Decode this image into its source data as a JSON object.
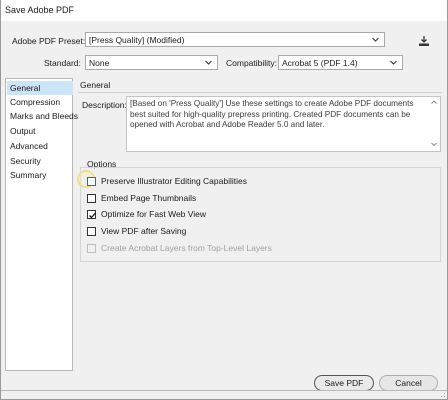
{
  "window": {
    "title": "Save Adobe PDF"
  },
  "preset": {
    "label": "Adobe PDF Preset:",
    "value": "[Press Quality] (Modified)"
  },
  "standard": {
    "label": "Standard:",
    "value": "None"
  },
  "compatibility": {
    "label": "Compatibility:",
    "value": "Acrobat 5 (PDF 1.4)"
  },
  "sidebar": {
    "items": [
      {
        "label": "General",
        "selected": true
      },
      {
        "label": "Compression"
      },
      {
        "label": "Marks and Bleeds"
      },
      {
        "label": "Output"
      },
      {
        "label": "Advanced"
      },
      {
        "label": "Security"
      },
      {
        "label": "Summary"
      }
    ]
  },
  "general": {
    "heading": "General",
    "description_label": "Description:",
    "description": "[Based on 'Press Quality'] Use these settings to create Adobe PDF documents best suited for high-quality prepress printing.  Created PDF documents can be opened with Acrobat and Adobe Reader 5.0 and later."
  },
  "options": {
    "title": "Options",
    "items": [
      {
        "label": "Preserve Illustrator Editing Capabilities",
        "checked": false,
        "enabled": true
      },
      {
        "label": "Embed Page Thumbnails",
        "checked": false,
        "enabled": true
      },
      {
        "label": "Optimize for Fast Web View",
        "checked": true,
        "enabled": true
      },
      {
        "label": "View PDF after Saving",
        "checked": false,
        "enabled": true
      },
      {
        "label": "Create Acrobat Layers from Top-Level Layers",
        "checked": false,
        "enabled": false
      }
    ]
  },
  "buttons": {
    "save": "Save PDF",
    "cancel": "Cancel"
  },
  "icons": {
    "save_preset": "save-preset-icon",
    "dropdown": "chevron-down-icon",
    "scroll_up": "scroll-up-arrow-icon",
    "scroll_down": "scroll-down-arrow-icon",
    "checkmark": "checkmark-icon"
  },
  "colors": {
    "selection": "#cce4f7",
    "focus": "#0078d7",
    "window_bg": "#f0f0f0"
  }
}
